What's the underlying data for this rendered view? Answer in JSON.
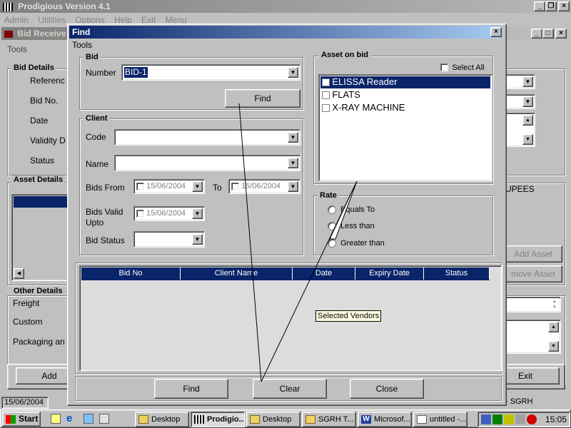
{
  "app": {
    "title": "Prodigious Version 4.1",
    "menu": [
      "Admin",
      "Utilities",
      "Options",
      "Help",
      "Exit",
      "Menu"
    ]
  },
  "bg_window": {
    "title": "Bid Receive",
    "menu_tools": "Tools",
    "bid_details_title": "Bid Details",
    "bid_details_labels": [
      "Referenc",
      "Bid No.",
      "Date",
      "Validity D",
      "Status"
    ],
    "asset_details_title": "Asset Details",
    "other_details_title": "Other Details",
    "other_labels": [
      "Freight",
      "Custom",
      "Packaging an"
    ],
    "right_text": "UPEES",
    "add_asset": "Add Asset",
    "remove_asset": "move Asset",
    "add_button": "Add",
    "exit_button": "Exit"
  },
  "status_bar": {
    "date": "15/06/2004",
    "right": "- SGRH"
  },
  "find": {
    "title": "Find",
    "menu_tools": "Tools",
    "bid_group": "Bid",
    "number_label": "Number",
    "number_value": "BID-1",
    "find_inner_button": "Find",
    "client_group": "Client",
    "code_label": "Code",
    "name_label": "Name",
    "bids_from_label": "Bids  From",
    "bids_from_value": "15/06/2004",
    "to_label": "To",
    "to_value": "15/06/2004",
    "valid_label_1": "Bids Valid",
    "valid_label_2": "Upto",
    "valid_value": "15/06/2004",
    "status_label": "Bid Status",
    "asset_group": "Asset on bid",
    "select_all": "Select All",
    "assets": [
      "ELISSA Reader",
      "FLATS",
      "X-RAY MACHINE"
    ],
    "rate_group": "Rate",
    "rate_options": [
      "Equals To",
      "Less than",
      "Greater than"
    ],
    "table_headers": [
      "Bid No",
      "Client Name",
      "Date",
      "Expiry Date",
      "Status"
    ],
    "tooltip": "Selected Vendors",
    "buttons": {
      "find": "Find",
      "clear": "Clear",
      "close": "Close"
    }
  },
  "taskbar": {
    "start": "Start",
    "items": [
      "Desktop",
      "Prodigio...",
      "Desktop",
      "SGRH T...",
      "Microsof...",
      "untitled -..."
    ],
    "clock": "15:05"
  },
  "colors": {
    "title_active": "#0a246a",
    "selection": "#0a246a",
    "window": "#c0c0c0"
  }
}
